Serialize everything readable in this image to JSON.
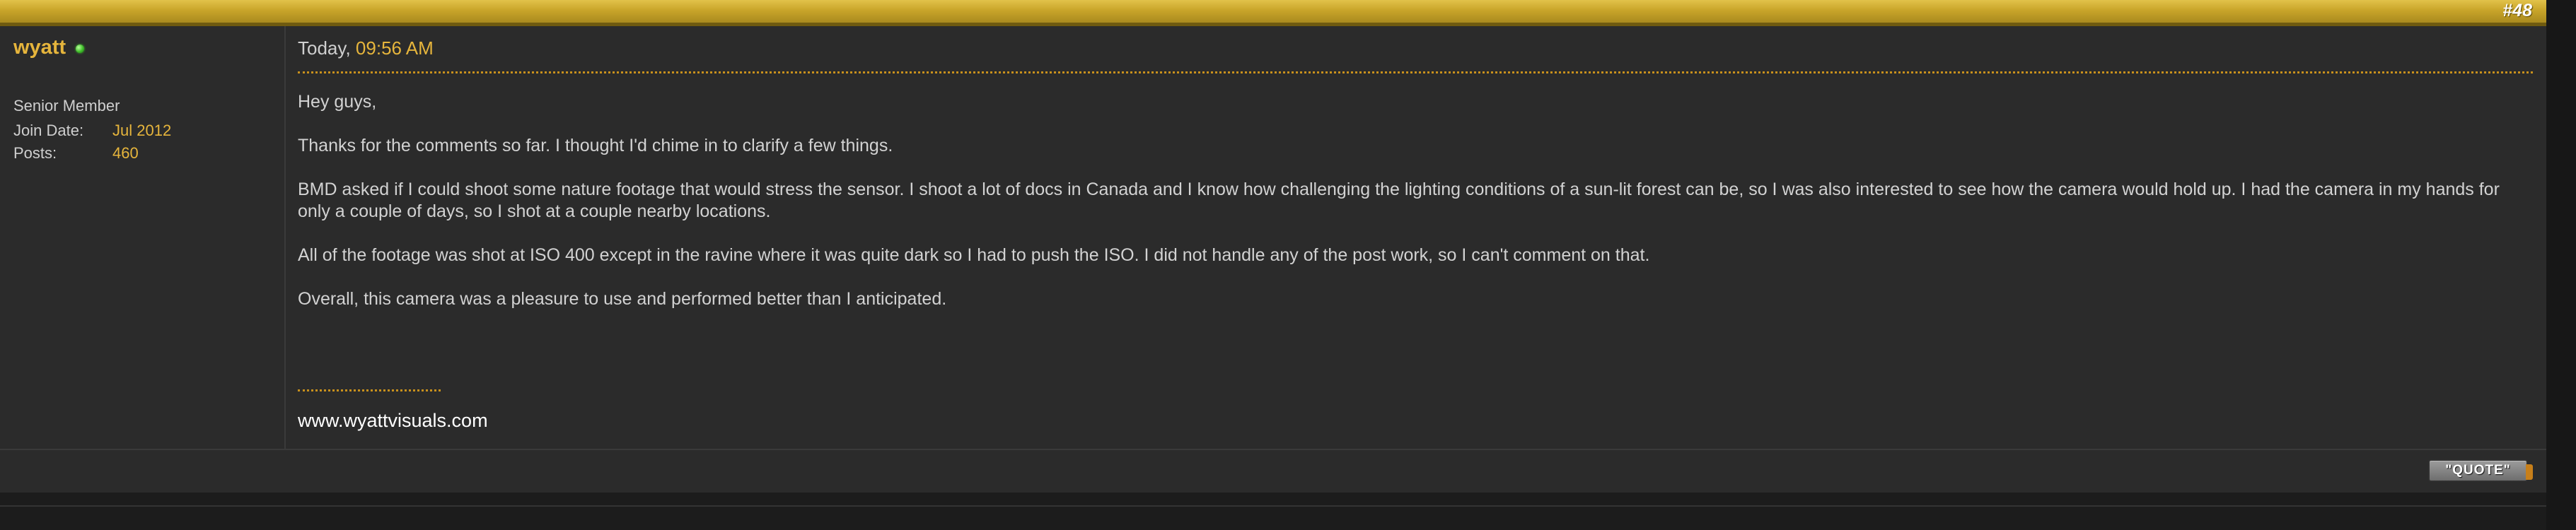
{
  "post": {
    "number": "#48",
    "author": {
      "username": "wyatt",
      "online": true,
      "title": "Senior Member",
      "join_date_label": "Join Date:",
      "join_date": "Jul 2012",
      "posts_label": "Posts:",
      "posts": "460"
    },
    "timestamp": {
      "day": "Today,",
      "time": "09:56 AM"
    },
    "message": [
      "Hey guys,",
      "Thanks for the comments so far. I thought I'd chime in to clarify a few things.",
      "BMD asked if I could shoot some nature footage that would stress the sensor. I shoot a lot of docs in Canada and I know how challenging the lighting conditions of a sun-lit forest can be, so I was also interested to see how the camera would hold up. I had the camera in my hands for only a couple of days, so I shot at a couple nearby locations.",
      "All of the footage was shot at ISO 400 except in the ravine where it was quite dark so I had to push the ISO. I did not handle any of the post work, so I can't comment on that.",
      "Overall, this camera was a pleasure to use and performed better than I anticipated."
    ],
    "signature": "www.wyattvisuals.com",
    "quote_label": "\"QUOTE\""
  },
  "colors": {
    "accent": "#e6b53c",
    "header_gold": "#c9a52a",
    "panel_bg": "#2b2b2b",
    "online": "#3fbe2a",
    "separator": "#c8901c"
  },
  "icons": {
    "online_status": "online-status-icon"
  }
}
